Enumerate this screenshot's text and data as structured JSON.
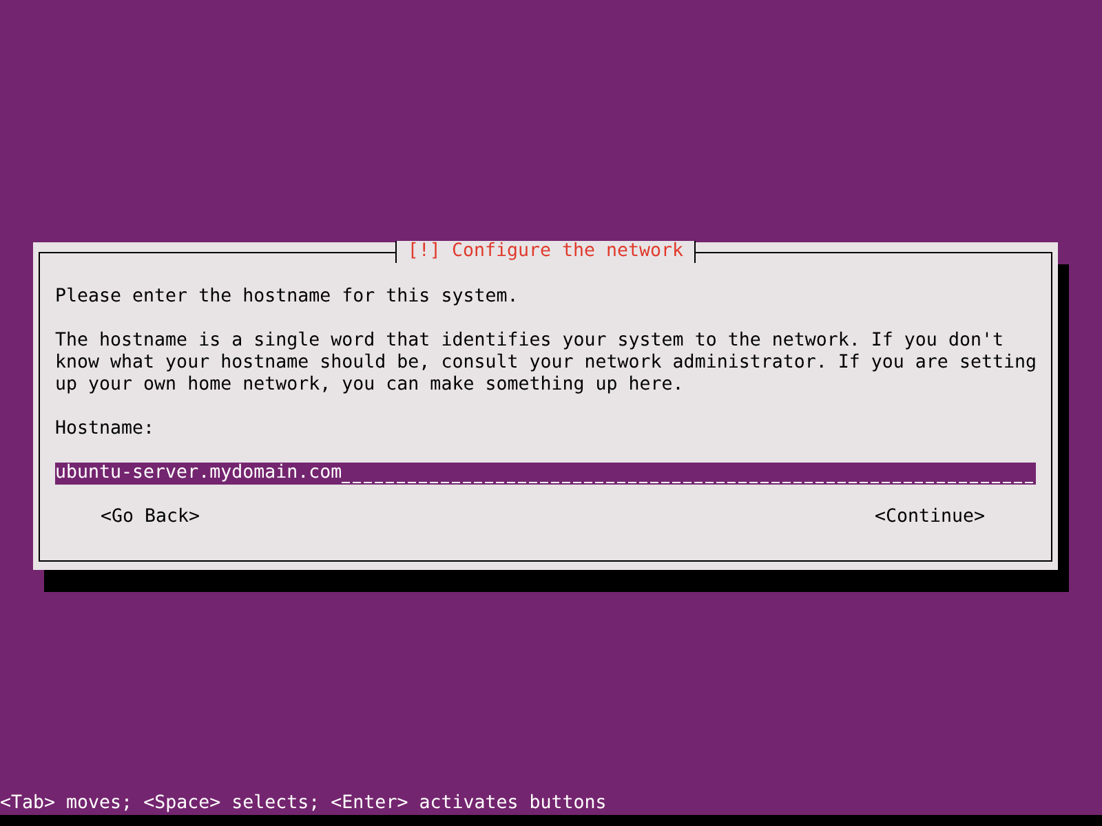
{
  "dialog": {
    "title": "[!] Configure the network",
    "paragraphs": [
      "Please enter the hostname for this system.",
      "The hostname is a single word that identifies your system to the network. If you don't know what your hostname should be, consult your network administrator. If you are setting up your own home network, you can make something up here."
    ],
    "field": {
      "label": "Hostname:",
      "value": "ubuntu-server.mydomain.com",
      "focused": true
    },
    "buttons": [
      {
        "label": "<Go Back>",
        "selected": false
      },
      {
        "label": "<Continue>",
        "selected": false
      }
    ]
  },
  "status_bar": "<Tab> moves; <Space> selects; <Enter> activates buttons"
}
